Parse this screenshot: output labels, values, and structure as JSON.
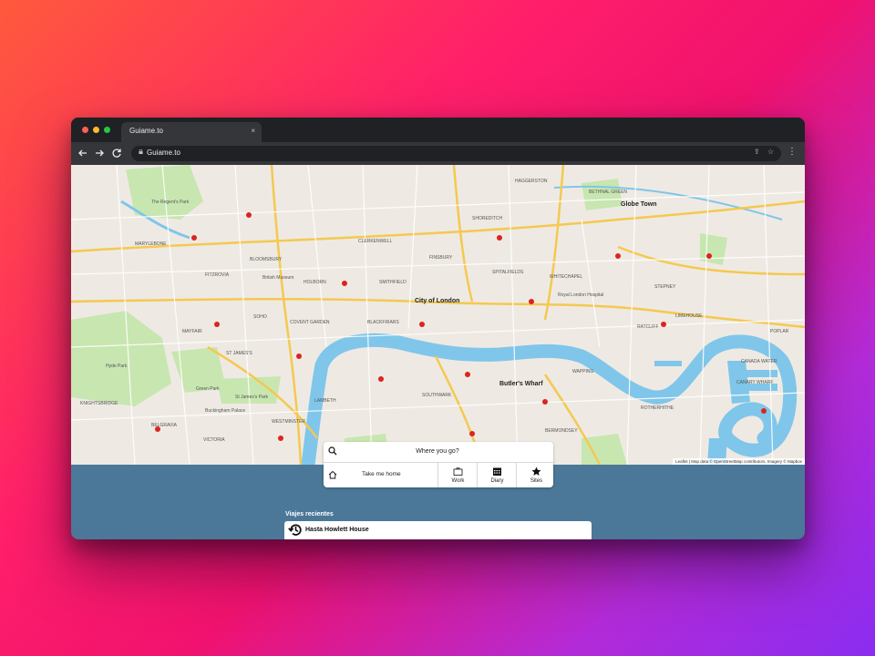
{
  "browser": {
    "tab_title": "Guiame.to",
    "tab_close": "×",
    "url": "Guiame.to",
    "traffic_lights": [
      "#ff5f57",
      "#febc2e",
      "#28c840"
    ]
  },
  "map": {
    "labels": [
      {
        "text": "City of London",
        "big": true
      },
      {
        "text": "Globe Town",
        "big": true
      },
      {
        "text": "Butler's Wharf",
        "big": true
      },
      {
        "text": "MARYLEBONE"
      },
      {
        "text": "FITZROVIA"
      },
      {
        "text": "BLOOMSBURY"
      },
      {
        "text": "CLERKENWELL"
      },
      {
        "text": "FINSBURY"
      },
      {
        "text": "SHOREDITCH"
      },
      {
        "text": "HAGGERSTON"
      },
      {
        "text": "BETHNAL GREEN"
      },
      {
        "text": "SPITALFIELDS"
      },
      {
        "text": "WHITECHAPEL"
      },
      {
        "text": "STEPNEY"
      },
      {
        "text": "LIMEHOUSE"
      },
      {
        "text": "POPLAR"
      },
      {
        "text": "RATCLIFF"
      },
      {
        "text": "WAPPING"
      },
      {
        "text": "ROTHERHITHE"
      },
      {
        "text": "BERMONDSEY"
      },
      {
        "text": "SOUTHWARK"
      },
      {
        "text": "LAMBETH"
      },
      {
        "text": "WESTMINSTER"
      },
      {
        "text": "MAYFAIR"
      },
      {
        "text": "ST JAMES'S"
      },
      {
        "text": "SOHO"
      },
      {
        "text": "COVENT GARDEN"
      },
      {
        "text": "HOLBORN"
      },
      {
        "text": "SMITHFIELD"
      },
      {
        "text": "BLACKFRIARS"
      },
      {
        "text": "BELGRAVIA"
      },
      {
        "text": "KNIGHTSBRIDGE"
      },
      {
        "text": "VICTORIA"
      },
      {
        "text": "Hyde Park"
      },
      {
        "text": "Green Park"
      },
      {
        "text": "St James's Park"
      },
      {
        "text": "The Regent's Park"
      },
      {
        "text": "Buckingham Palace"
      },
      {
        "text": "British Museum"
      },
      {
        "text": "Royal London Hospital"
      },
      {
        "text": "CANADA WATER"
      },
      {
        "text": "CANARY WHARF"
      }
    ],
    "attribution": "Leaflet | Map data © OpenStreetMap contributors, Imagery © Mapbox"
  },
  "search": {
    "placeholder": "Where you go?"
  },
  "quick_actions": {
    "home_label": "Take me home",
    "work_label": "Work",
    "diary_label": "Diary",
    "sites_label": "Sites"
  },
  "recent": {
    "title": "Viajes recientes",
    "items": [
      {
        "label": "Hasta Howlett House"
      }
    ]
  },
  "colors": {
    "water": "#7fc6ea",
    "park": "#c8e6b0",
    "land": "#eeeae3",
    "panel_bg": "#4b7898",
    "major_road": "#f5c851"
  }
}
